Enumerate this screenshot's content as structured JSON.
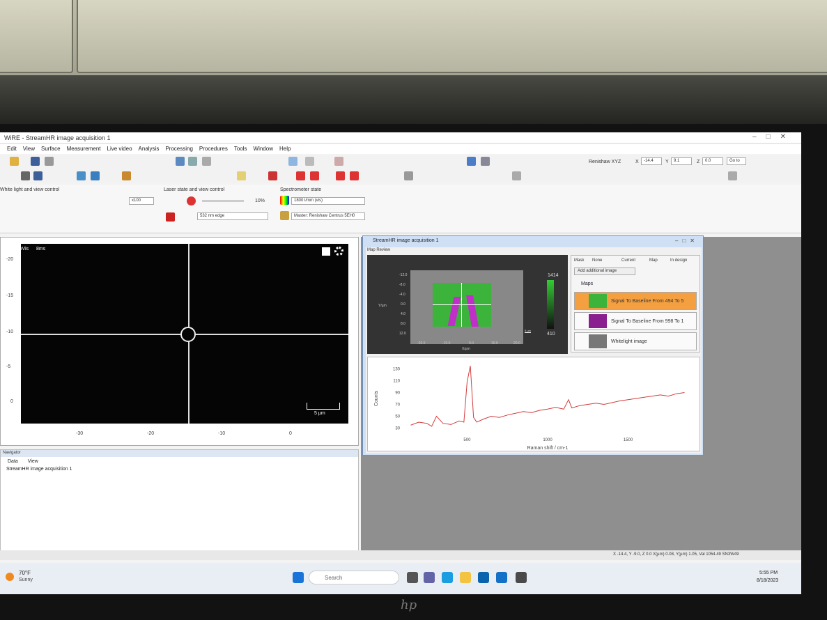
{
  "window": {
    "title": "WiRE - StreamHR image acquisition 1"
  },
  "menu": [
    "Edit",
    "View",
    "Surface",
    "Measurement",
    "Live video",
    "Analysis",
    "Processing",
    "Procedures",
    "Tools",
    "Window",
    "Help"
  ],
  "toolbar": {
    "coord_label": "Renishaw XYZ",
    "x_label": "X",
    "x_value": "-14.4",
    "y_label": "Y",
    "y_value": "9.1",
    "z_label": "Z",
    "z_value": "0.0",
    "goto_label": "Go to"
  },
  "white_light": {
    "title": "White light and view control",
    "objective": "x100"
  },
  "laser": {
    "title": "Laser state and view control",
    "power": "10%",
    "line": "532 nm edge"
  },
  "spectrometer": {
    "title": "Spectrometer state",
    "grating": "1800 l/mm (vis)",
    "master": "Master: Renishaw Centrus 5EH0"
  },
  "video": {
    "label_mode": "inVis",
    "label_time": "8ms",
    "scale": "5 µm",
    "yticks": [
      "-20",
      "-15",
      "-10",
      "-5",
      "0"
    ],
    "xticks": [
      "-30",
      "-20",
      "-10",
      "0"
    ]
  },
  "navigator": {
    "title": "Navigator",
    "tab_data": "Data",
    "tab_view": "View",
    "item": "StreamHR image acquisition 1"
  },
  "mapwin": {
    "title": "StreamHR image acquisition 1",
    "review_label": "Map Review",
    "mask_label": "Mask",
    "mask_options": [
      "None",
      "Current",
      "Map",
      "In design"
    ],
    "add_image": "Add additional image",
    "maps_label": "Maps",
    "items": [
      "Signal To Baseline From 494 To 5",
      "Signal To Baseline From 998 To 1",
      "Whitelight image"
    ],
    "colorbar_max": "1414",
    "colorbar_min": "410",
    "map_yticks": [
      "-12.0",
      "-8.0",
      "-4.0",
      "0.0",
      "4.0",
      "8.0",
      "12.0"
    ],
    "map_xticks": [
      "-20.0",
      "-10.0",
      "0.0",
      "10.0",
      "20.0"
    ],
    "map_ylabel": "Y/µm",
    "map_xlabel": "X/µm",
    "scale": "5 µm"
  },
  "chart_data": {
    "type": "line",
    "xlabel": "Raman shift / cm-1",
    "ylabel": "Counts",
    "xticks": [
      "500",
      "1000",
      "1500"
    ],
    "yticks": [
      "30",
      "50",
      "70",
      "90",
      "110",
      "130"
    ],
    "xlim": [
      100,
      1900
    ],
    "ylim": [
      20,
      140
    ],
    "series": [
      {
        "color": "#d23c3c",
        "x": [
          150,
          200,
          250,
          280,
          310,
          350,
          400,
          450,
          480,
          500,
          520,
          540,
          560,
          600,
          650,
          700,
          750,
          800,
          850,
          900,
          950,
          1000,
          1050,
          1100,
          1130,
          1150,
          1200,
          1250,
          1300,
          1350,
          1400,
          1450,
          1500,
          1550,
          1600,
          1650,
          1700,
          1750,
          1800,
          1850
        ],
        "values": [
          35,
          40,
          38,
          33,
          50,
          38,
          36,
          42,
          40,
          108,
          135,
          48,
          40,
          45,
          50,
          48,
          52,
          55,
          58,
          56,
          60,
          62,
          65,
          62,
          78,
          64,
          68,
          70,
          72,
          70,
          73,
          76,
          78,
          80,
          82,
          84,
          86,
          84,
          88,
          90
        ]
      }
    ]
  },
  "status": {
    "text": "X -14.4, Y -9.0, Z 0.0  X(µm) 0.08, Y(µm) 1.05, Val 1054.49  SN3W49"
  },
  "taskbar": {
    "weather_temp": "70°F",
    "weather_desc": "Sunny",
    "search": "Search",
    "time": "5:55 PM",
    "date": "8/18/2023"
  },
  "monitor_brand": "hp"
}
